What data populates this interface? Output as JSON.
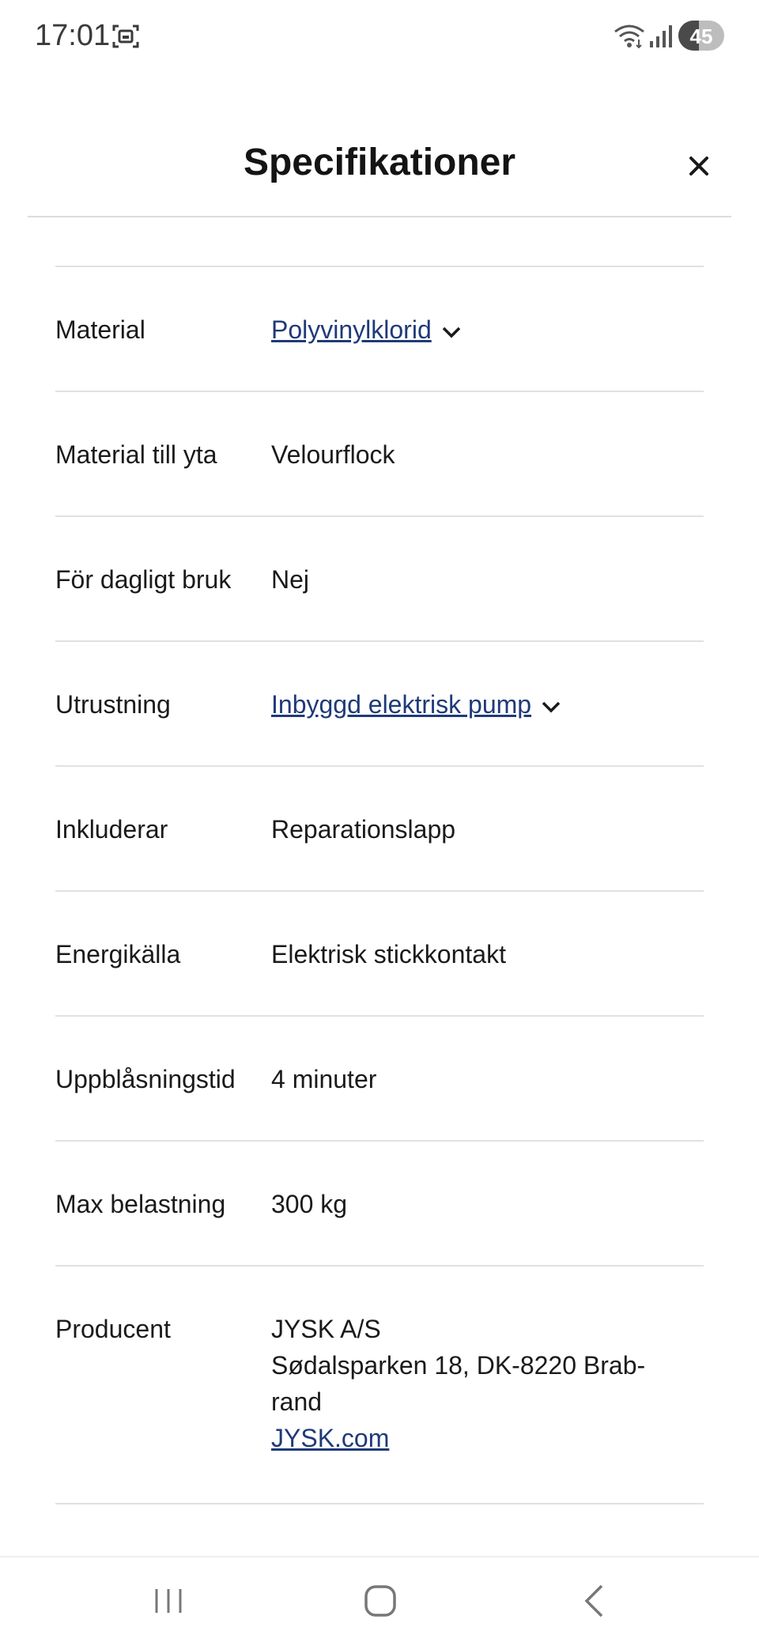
{
  "status_bar": {
    "time": "17:01",
    "battery": "45",
    "battery_level": 0.45,
    "icons": [
      "screen-capture-icon",
      "wifi-icon",
      "signal-icon",
      "battery-icon"
    ]
  },
  "header": {
    "title": "Specifikationer",
    "close_icon": "close-icon"
  },
  "specs": [
    {
      "label": "Material",
      "value": "Polyvinylklorid",
      "link": true,
      "expandable": true
    },
    {
      "label": "Material till yta",
      "value": "Velourflock"
    },
    {
      "label": "För dagligt bruk",
      "value": "Nej"
    },
    {
      "label": "Utrustning",
      "value": "Inbyggd elektrisk pump",
      "link": true,
      "expandable": true
    },
    {
      "label": "Inkluderar",
      "value": "Reparationslapp"
    },
    {
      "label": "Energikälla",
      "value": "Elektrisk stickkontakt"
    },
    {
      "label": "Uppblåsningstid",
      "value": "4 minuter"
    },
    {
      "label": "Max belastning",
      "value": "300 kg"
    }
  ],
  "producer": {
    "label": "Producent",
    "name": "JYSK A/S",
    "address_line1": "Sødalsparken 18, DK-8220 Brab-",
    "address_line2": "rand",
    "website": "JYSK.com"
  },
  "nav_bar": {
    "icons": [
      "recent-apps-icon",
      "home-icon",
      "back-icon"
    ]
  },
  "colors": {
    "link": "#1f3a78",
    "divider": "#e1e1e1",
    "text": "#1a1a1a"
  }
}
